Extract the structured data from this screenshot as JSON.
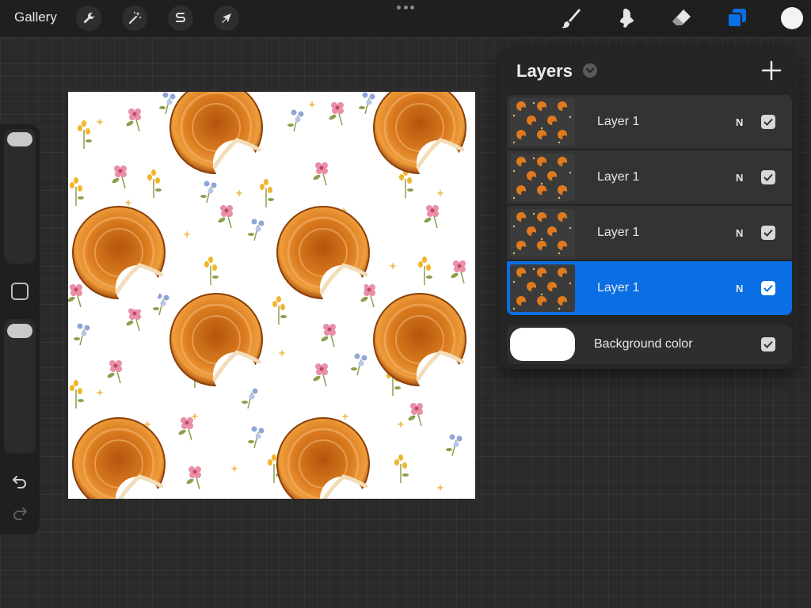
{
  "toolbar": {
    "gallery_label": "Gallery",
    "actions_icon": "wrench-icon",
    "adjustments_icon": "magic-wand-icon",
    "selection_icon": "selection-s-icon",
    "transform_icon": "arrow-cursor-icon",
    "brush_icon": "brush-icon",
    "smudge_icon": "smudge-icon",
    "eraser_icon": "eraser-icon",
    "layers_icon": "layers-icon",
    "color": "#f4f4f4"
  },
  "layers_panel": {
    "title": "Layers",
    "add_icon": "plus-icon",
    "layers": [
      {
        "name": "Layer 1",
        "blend": "N",
        "visible": true,
        "selected": false
      },
      {
        "name": "Layer 1",
        "blend": "N",
        "visible": true,
        "selected": false
      },
      {
        "name": "Layer 1",
        "blend": "N",
        "visible": true,
        "selected": false
      },
      {
        "name": "Layer 1",
        "blend": "N",
        "visible": true,
        "selected": true
      }
    ],
    "background": {
      "name": "Background color",
      "color": "#ffffff",
      "visible": true
    }
  },
  "colors": {
    "accent": "#0a6fe4",
    "canvas_bg": "#ffffff",
    "pastry": "#d97a1e",
    "flower_pink": "#e98fa8",
    "flower_yellow": "#f0b52a",
    "flower_blue": "#8ea6d8",
    "leaf": "#8aa04e"
  }
}
